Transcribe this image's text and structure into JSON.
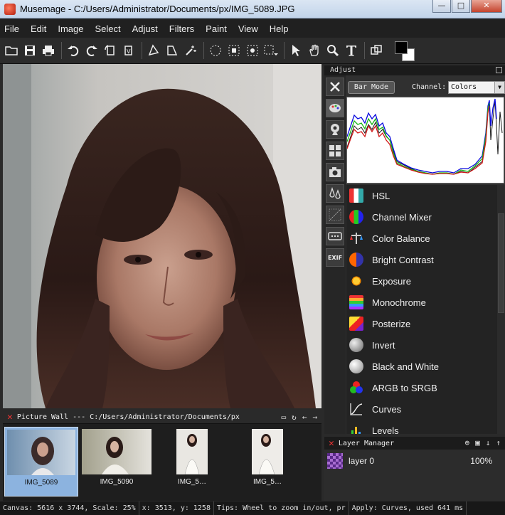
{
  "window": {
    "title": "Musemage - C:/Users/Administrator/Documents/px/IMG_5089.JPG",
    "minimize": "—",
    "maximize": "□",
    "close": "✕"
  },
  "menu": [
    "File",
    "Edit",
    "Image",
    "Select",
    "Adjust",
    "Filters",
    "Paint",
    "View",
    "Help"
  ],
  "adjust_panel": {
    "title": "Adjust",
    "bar_mode": "Bar Mode",
    "channel_label": "Channel:",
    "channel_value": "Colors",
    "items": [
      {
        "label": "HSL",
        "icon": "hsl-icon"
      },
      {
        "label": "Channel Mixer",
        "icon": "channel-mixer-icon"
      },
      {
        "label": "Color Balance",
        "icon": "color-balance-icon"
      },
      {
        "label": "Bright Contrast",
        "icon": "bright-contrast-icon"
      },
      {
        "label": "Exposure",
        "icon": "exposure-icon"
      },
      {
        "label": "Monochrome",
        "icon": "monochrome-icon"
      },
      {
        "label": "Posterize",
        "icon": "posterize-icon"
      },
      {
        "label": "Invert",
        "icon": "invert-icon"
      },
      {
        "label": "Black and White",
        "icon": "black-and-white-icon"
      },
      {
        "label": "ARGB to SRGB",
        "icon": "argb-to-srgb-icon"
      },
      {
        "label": "Curves",
        "icon": "curves-icon"
      },
      {
        "label": "Levels",
        "icon": "levels-icon"
      }
    ],
    "side_tools": [
      "tools-icon",
      "palette-icon",
      "webcam-icon",
      "grid-icon",
      "camera-icon",
      "drops-icon",
      "texture-icon",
      "dialog-icon",
      "exif-icon"
    ],
    "exif_label": "EXIF"
  },
  "layer_manager": {
    "title": "Layer Manager",
    "layer_name": "layer 0",
    "opacity": "100%"
  },
  "picture_wall": {
    "title": "Picture Wall --- C:/Users/Administrator/Documents/px",
    "thumbs": [
      {
        "caption": "IMG_5089"
      },
      {
        "caption": "IMG_5090"
      },
      {
        "caption": "IMG_5…"
      },
      {
        "caption": "IMG_5…"
      }
    ]
  },
  "status": {
    "canvas": "Canvas: 5616 x 3744, Scale: 25%",
    "coords": "x: 3513, y: 1258",
    "tips": "Tips: Wheel to zoom in/out, pr",
    "apply": "Apply: Curves, used 641 ms"
  },
  "colors": {
    "accent": "#8cb3df",
    "panel_bg": "#303030",
    "fg_color": "#000000",
    "bg_color": "#ffffff"
  }
}
